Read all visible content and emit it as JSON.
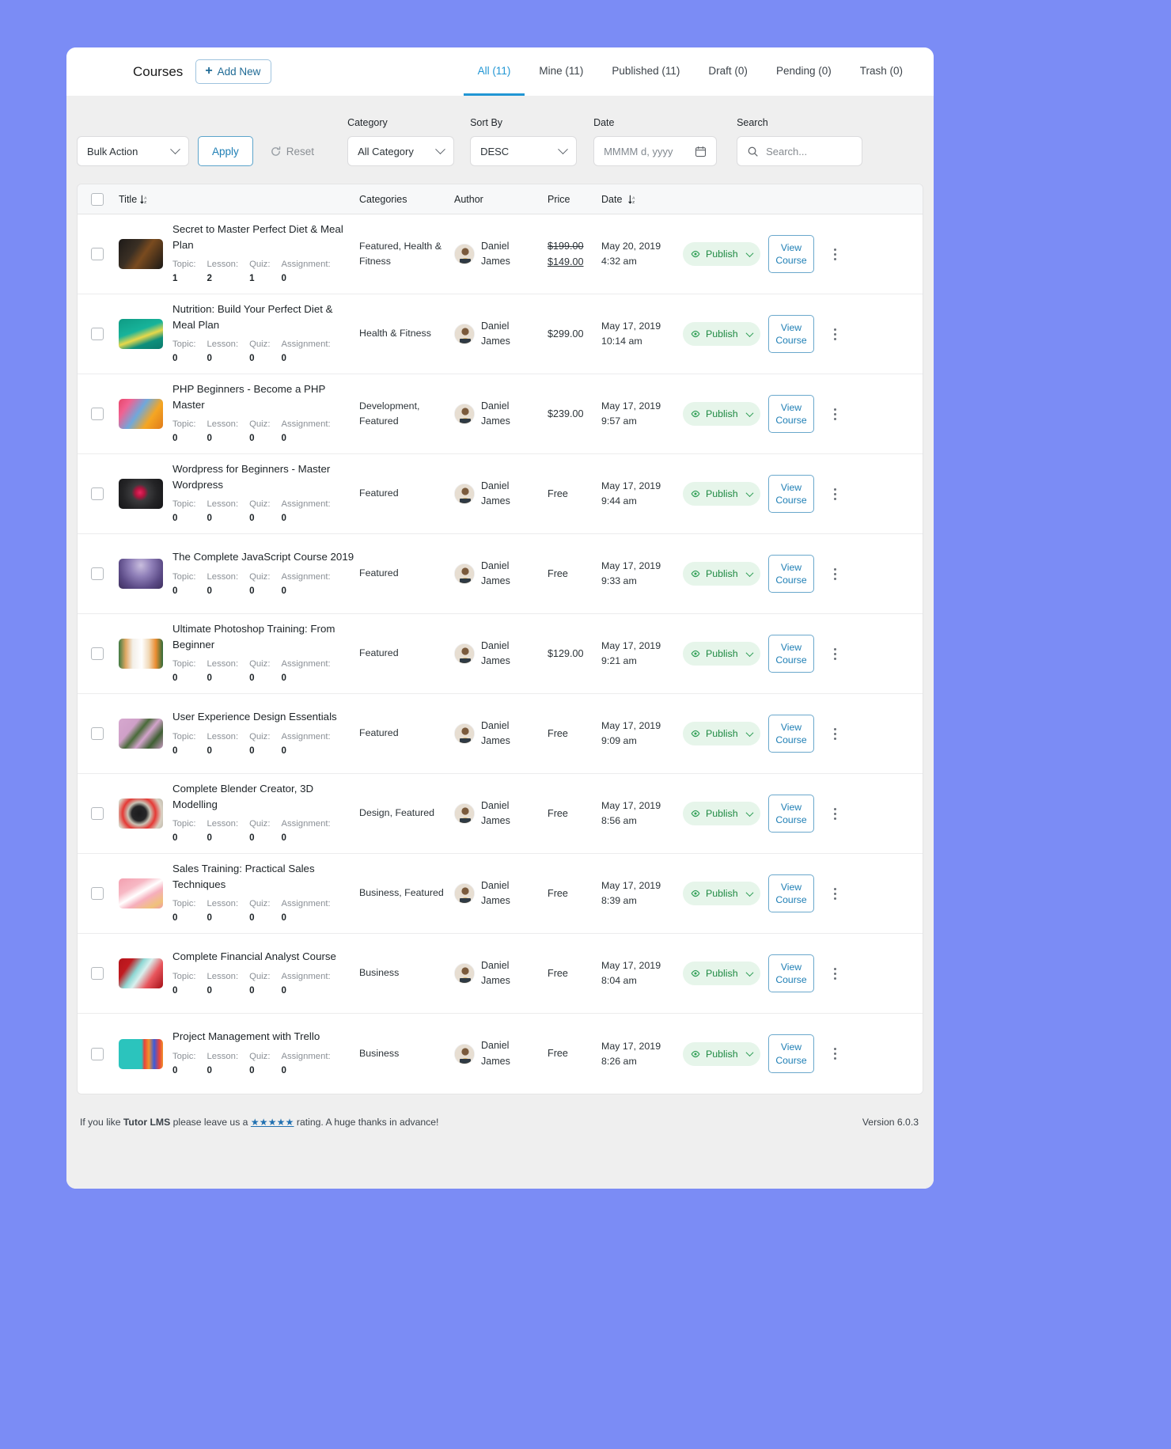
{
  "header": {
    "title": "Courses",
    "add_new_label": "Add New",
    "tabs": [
      {
        "label": "All (11)",
        "active": true
      },
      {
        "label": "Mine (11)",
        "active": false
      },
      {
        "label": "Published (11)",
        "active": false
      },
      {
        "label": "Draft (0)",
        "active": false
      },
      {
        "label": "Pending (0)",
        "active": false
      },
      {
        "label": "Trash (0)",
        "active": false
      }
    ]
  },
  "filters": {
    "bulk_action_value": "Bulk Action",
    "apply_label": "Apply",
    "reset_label": "Reset",
    "category_label": "Category",
    "category_value": "All Category",
    "sort_label": "Sort By",
    "sort_value": "DESC",
    "date_label": "Date",
    "date_placeholder": "MMMM d, yyyy",
    "search_label": "Search",
    "search_placeholder": "Search...",
    "search_value": ""
  },
  "table": {
    "columns": {
      "title": "Title",
      "categories": "Categories",
      "author": "Author",
      "price": "Price",
      "date": "Date"
    },
    "meta_labels": {
      "topic": "Topic:",
      "lesson": "Lesson:",
      "quiz": "Quiz:",
      "assignment": "Assignment:"
    },
    "status_label": "Publish",
    "view_label": "View Course",
    "rows": [
      {
        "title": "Secret to Master Perfect Diet & Meal Plan",
        "topic": "1",
        "lesson": "2",
        "quiz": "1",
        "assignment": "0",
        "categories": "Featured, Health & Fitness",
        "author": "Daniel James",
        "price_old": "$199.00",
        "price_new": "$149.00",
        "price": "",
        "date": "May 20, 2019",
        "time": "4:32 am",
        "status": "Publish",
        "thumb": "linear-gradient(125deg,#1d1a18 0%,#3a2f24 35%,#7a4b1f 55%,#1a1816 100%)"
      },
      {
        "title": "Nutrition: Build Your Perfect Diet & Meal Plan",
        "topic": "0",
        "lesson": "0",
        "quiz": "0",
        "assignment": "0",
        "categories": "Health & Fitness",
        "author": "Daniel James",
        "price_old": "",
        "price_new": "",
        "price": "$299.00",
        "date": "May 17, 2019",
        "time": "10:14 am",
        "status": "Publish",
        "thumb": "linear-gradient(160deg,#0f9b84 0%,#17b39a 40%,#e8d84a 58%,#0e8f7c 75%,#0c7a6c 100%)"
      },
      {
        "title": "PHP Beginners - Become a PHP Master",
        "topic": "0",
        "lesson": "0",
        "quiz": "0",
        "assignment": "0",
        "categories": "Development, Featured",
        "author": "Daniel James",
        "price_old": "",
        "price_new": "",
        "price": "$239.00",
        "date": "May 17, 2019",
        "time": "9:57 am",
        "status": "Publish",
        "thumb": "linear-gradient(125deg,#e8466b 0%,#f06292 20%,#6fa8dc 45%,#f5a623 70%,#e07b1a 100%)"
      },
      {
        "title": "Wordpress for Beginners - Master Wordpress",
        "topic": "0",
        "lesson": "0",
        "quiz": "0",
        "assignment": "0",
        "categories": "Featured",
        "author": "Daniel James",
        "price_old": "",
        "price_new": "",
        "price": "Free",
        "date": "May 17, 2019",
        "time": "9:44 am",
        "status": "Publish",
        "thumb": "radial-gradient(circle at 48% 46%, #e8255f 0%, #b3143f 16%, #3a3a3c 30%, #242426 60%, #151517 100%)"
      },
      {
        "title": "The Complete JavaScript Course 2019",
        "topic": "0",
        "lesson": "0",
        "quiz": "0",
        "assignment": "0",
        "categories": "Featured",
        "author": "Daniel James",
        "price_old": "",
        "price_new": "",
        "price": "Free",
        "date": "May 17, 2019",
        "time": "9:33 am",
        "status": "Publish",
        "thumb": "radial-gradient(ellipse at 50% 22%, #c9bede 0%, #8f7fb8 35%, #5b4a86 70%, #3d2f5e 100%)"
      },
      {
        "title": "Ultimate Photoshop Training: From Beginner",
        "topic": "0",
        "lesson": "0",
        "quiz": "0",
        "assignment": "0",
        "categories": "Featured",
        "author": "Daniel James",
        "price_old": "",
        "price_new": "",
        "price": "$129.00",
        "date": "May 17, 2019",
        "time": "9:21 am",
        "status": "Publish",
        "thumb": "linear-gradient(90deg,#3e7a43 0%,#e0a864 16%,#f3efe8 32%,#ffffff 52%,#f0d9b8 68%,#e98c30 84%,#2f6b3a 100%)"
      },
      {
        "title": "User Experience Design Essentials",
        "topic": "0",
        "lesson": "0",
        "quiz": "0",
        "assignment": "0",
        "categories": "Featured",
        "author": "Daniel James",
        "price_old": "",
        "price_new": "",
        "price": "Free",
        "date": "May 17, 2019",
        "time": "9:09 am",
        "status": "Publish",
        "thumb": "linear-gradient(130deg,#d6a8cf 0%,#cfa0c8 30%,#4a6b3a 45%,#d3a4cc 60%,#3f5f33 78%,#c79ac1 100%)"
      },
      {
        "title": "Complete Blender Creator, 3D Modelling",
        "topic": "0",
        "lesson": "0",
        "quiz": "0",
        "assignment": "0",
        "categories": "Design, Featured",
        "author": "Daniel James",
        "price_old": "",
        "price_new": "",
        "price": "Free",
        "date": "May 17, 2019",
        "time": "8:56 am",
        "status": "Publish",
        "thumb": "radial-gradient(circle at 46% 50%, #1b1b1d 0%, #262628 26%, #c9c2b4 40%, #e53935 58%, #d9d2c4 80%, #bfb8aa 100%)"
      },
      {
        "title": "Sales Training: Practical Sales Techniques",
        "topic": "0",
        "lesson": "0",
        "quiz": "0",
        "assignment": "0",
        "categories": "Business, Featured",
        "author": "Daniel James",
        "price_old": "",
        "price_new": "",
        "price": "Free",
        "date": "May 17, 2019",
        "time": "8:39 am",
        "status": "Publish",
        "thumb": "linear-gradient(150deg,#f3a0b0 0%,#f7b8c4 30%,#ffffff 48%,#f6aebc 64%,#f0c27a 86%,#ef9aa8 100%)"
      },
      {
        "title": "Complete Financial Analyst Course",
        "topic": "0",
        "lesson": "0",
        "quiz": "0",
        "assignment": "0",
        "categories": "Business",
        "author": "Daniel James",
        "price_old": "",
        "price_new": "",
        "price": "Free",
        "date": "May 17, 2019",
        "time": "8:04 am",
        "status": "Publish",
        "thumb": "linear-gradient(125deg,#b3141b 0%,#c11a20 22%,#8fd8d4 40%,#d8f0ee 52%,#e8555c 72%,#a40f16 100%)"
      },
      {
        "title": "Project Management with Trello",
        "topic": "0",
        "lesson": "0",
        "quiz": "0",
        "assignment": "0",
        "categories": "Business",
        "author": "Daniel James",
        "price_old": "",
        "price_new": "",
        "price": "Free",
        "date": "May 17, 2019",
        "time": "8:26 am",
        "status": "Publish",
        "thumb": "linear-gradient(90deg,#2bc4bd 0%,#2bc4bd 52%,#e8433a 58%,#f0932b 68%,#3b5bdb 80%,#e8433a 92%,#f0932b 100%)"
      }
    ]
  },
  "footer": {
    "text_before": "If you like ",
    "brand": "Tutor LMS",
    "text_mid": " please leave us a ",
    "stars": "★★★★★",
    "text_after": " rating. A huge thanks in advance!",
    "version": "Version 6.0.3"
  },
  "colors": {
    "accent": "#2196d4",
    "link": "#1f7fb5",
    "status_green": "#1f8a43",
    "page_bg": "#7b8cf5"
  }
}
